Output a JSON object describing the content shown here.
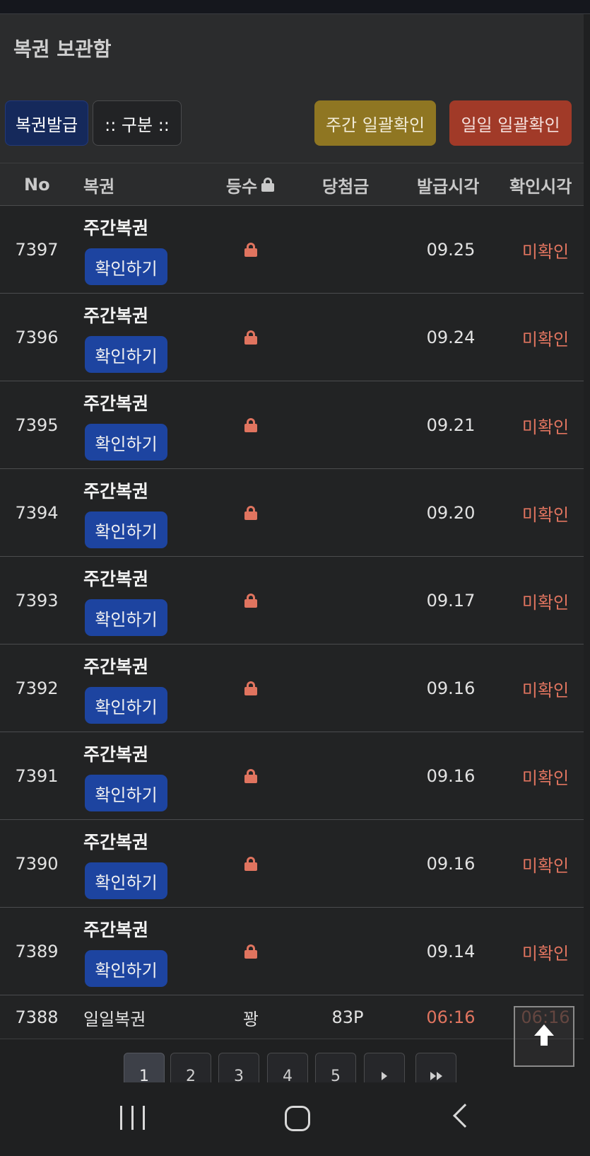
{
  "page": {
    "title": "복권 보관함"
  },
  "toolbar": {
    "issue_label": "복권발급",
    "filter_label": ":: 구분 ::",
    "weekly_label": "주간 일괄확인",
    "daily_label": "일일 일괄확인"
  },
  "table": {
    "headers": {
      "no": "No",
      "type": "복권",
      "rank": "등수",
      "prize": "당첨금",
      "issued": "발급시각",
      "confirmed": "확인시각"
    },
    "rows": [
      {
        "no": "7397",
        "type": "주간복권",
        "action": "확인하기",
        "issued": "09.25",
        "confirmed": "미확인"
      },
      {
        "no": "7396",
        "type": "주간복권",
        "action": "확인하기",
        "issued": "09.24",
        "confirmed": "미확인"
      },
      {
        "no": "7395",
        "type": "주간복권",
        "action": "확인하기",
        "issued": "09.21",
        "confirmed": "미확인"
      },
      {
        "no": "7394",
        "type": "주간복권",
        "action": "확인하기",
        "issued": "09.20",
        "confirmed": "미확인"
      },
      {
        "no": "7393",
        "type": "주간복권",
        "action": "확인하기",
        "issued": "09.17",
        "confirmed": "미확인"
      },
      {
        "no": "7392",
        "type": "주간복권",
        "action": "확인하기",
        "issued": "09.16",
        "confirmed": "미확인"
      },
      {
        "no": "7391",
        "type": "주간복권",
        "action": "확인하기",
        "issued": "09.16",
        "confirmed": "미확인"
      },
      {
        "no": "7390",
        "type": "주간복권",
        "action": "확인하기",
        "issued": "09.16",
        "confirmed": "미확인"
      },
      {
        "no": "7389",
        "type": "주간복권",
        "action": "확인하기",
        "issued": "09.14",
        "confirmed": "미확인"
      }
    ],
    "last_row": {
      "no": "7388",
      "type": "일일복권",
      "rank": "꽝",
      "prize": "83P",
      "issued": "06:16",
      "confirmed": "06:16"
    }
  },
  "pagination": {
    "pages": [
      "1",
      "2",
      "3",
      "4",
      "5"
    ],
    "current": "1"
  },
  "icons": {
    "lock": "lock-icon",
    "scroll_top": "arrow-up-icon",
    "next": "chevron-right-icon",
    "last": "double-chevron-right-icon"
  },
  "colors": {
    "issue_button": "#15295b",
    "weekly_button": "#8f7622",
    "daily_button": "#a13a28",
    "check_button": "#1d44a0",
    "unconfirmed": "#e0745f"
  }
}
